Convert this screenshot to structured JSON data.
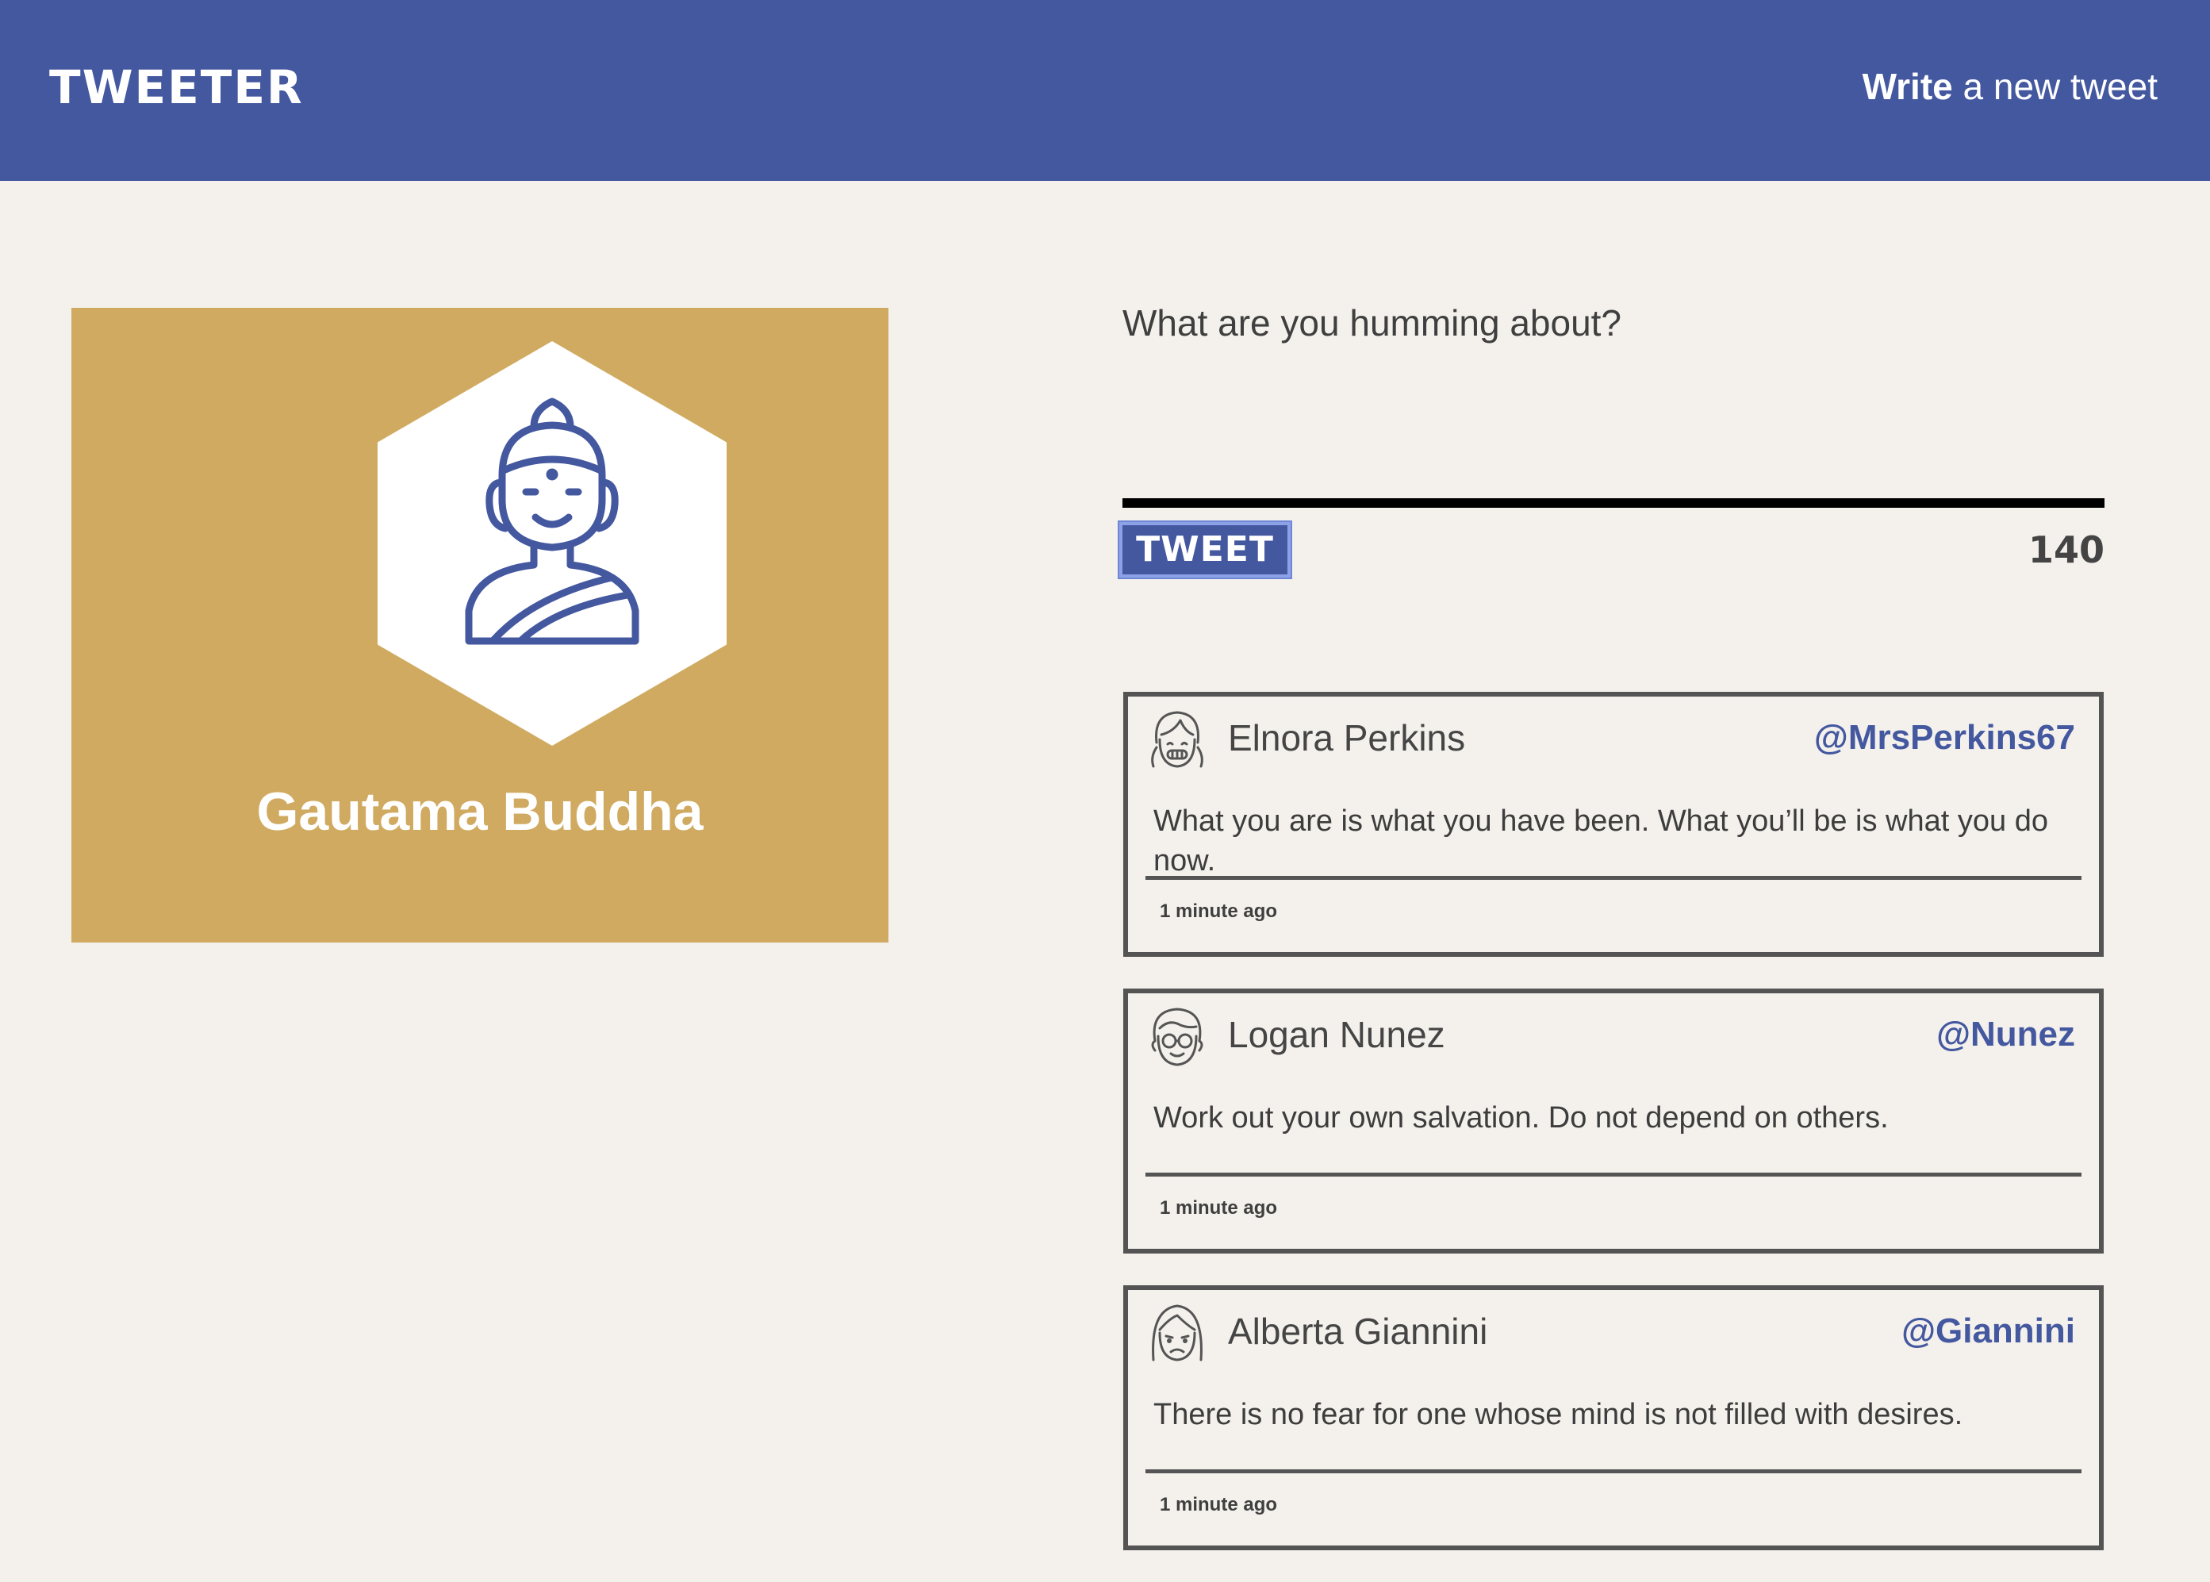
{
  "nav": {
    "brand": "TWEETER",
    "compose_bold": "Write",
    "compose_rest": "a new tweet"
  },
  "profile": {
    "name": "Gautama Buddha",
    "avatar_icon": "buddha-icon",
    "background_color": "#d0aa60"
  },
  "composer": {
    "placeholder": "What are you humming about?",
    "button_label": "TWEET",
    "counter": "140"
  },
  "tweets": [
    {
      "author": "Elnora Perkins",
      "handle": "@MrsPerkins67",
      "text": "What you are is what you have been. What you’ll be is what you do now.",
      "time": "1 minute ago",
      "avatar_icon": "girl-avatar-icon"
    },
    {
      "author": "Logan Nunez",
      "handle": "@Nunez",
      "text": "Work out your own salvation. Do not depend on others.",
      "time": "1 minute ago",
      "avatar_icon": "boy-glasses-avatar-icon"
    },
    {
      "author": "Alberta Giannini",
      "handle": "@Giannini",
      "text": "There is no fear for one whose mind is not filled with desires.",
      "time": "1 minute ago",
      "avatar_icon": "woman-avatar-icon"
    }
  ],
  "colors": {
    "nav_background": "#4458a0",
    "page_background": "#f4f1ec",
    "accent": "#4458a0",
    "border": "#545454"
  }
}
